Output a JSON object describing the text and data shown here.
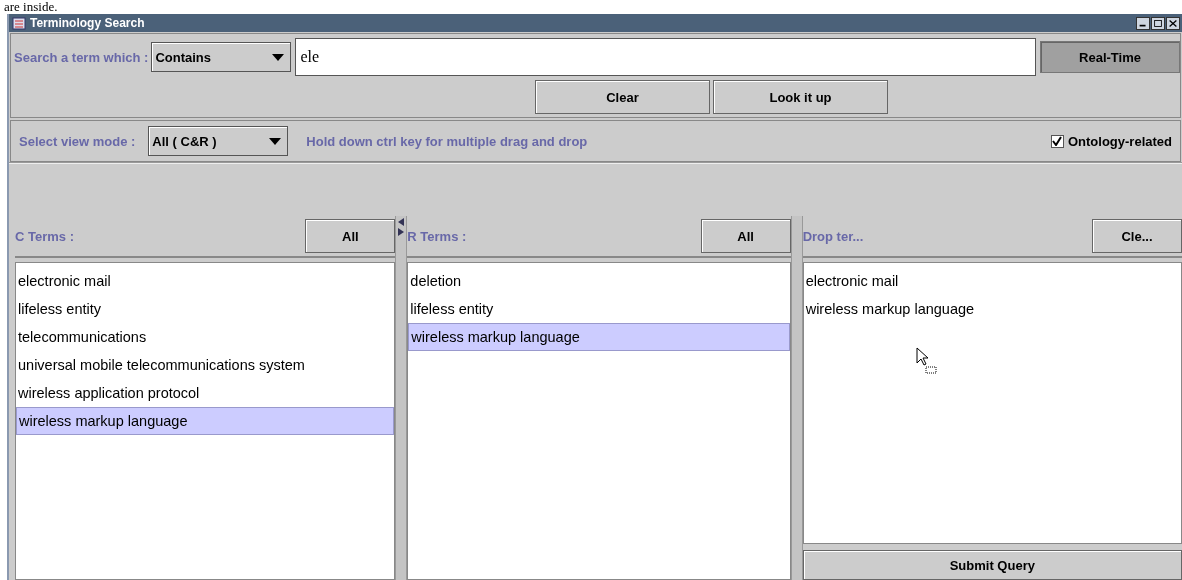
{
  "page_fragment": "are inside.",
  "window": {
    "title": "Terminology Search"
  },
  "search": {
    "label": "Search a term which :",
    "match_mode": "Contains",
    "value": "ele",
    "realtime": {
      "label": "Real-Time",
      "pressed": true
    },
    "buttons": [
      "Clear",
      "Look it up"
    ]
  },
  "view": {
    "label": "Select view mode :",
    "mode": "All ( C&R )",
    "hint": "Hold down ctrl key for multiple drag and drop",
    "ontology": {
      "label": "Ontology-related",
      "checked": true
    }
  },
  "panels": [
    {
      "kind": "terms",
      "title": "C Terms :",
      "button": "All",
      "items": [
        {
          "label": "electronic mail",
          "selected": false
        },
        {
          "label": "lifeless entity",
          "selected": false
        },
        {
          "label": "telecommunications",
          "selected": false
        },
        {
          "label": "universal mobile telecommunications system",
          "selected": false
        },
        {
          "label": "wireless application protocol",
          "selected": false
        },
        {
          "label": "wireless markup language",
          "selected": true
        }
      ]
    },
    {
      "kind": "terms",
      "title": "R Terms :",
      "button": "All",
      "items": [
        {
          "label": "deletion",
          "selected": false
        },
        {
          "label": "lifeless entity",
          "selected": false
        },
        {
          "label": "wireless markup language",
          "selected": true
        }
      ]
    },
    {
      "kind": "drop",
      "title": "Drop ter...",
      "button": "Cle...",
      "items": [
        {
          "label": "electronic mail"
        },
        {
          "label": "wireless markup language"
        }
      ],
      "action_button": "Submit Query"
    }
  ]
}
